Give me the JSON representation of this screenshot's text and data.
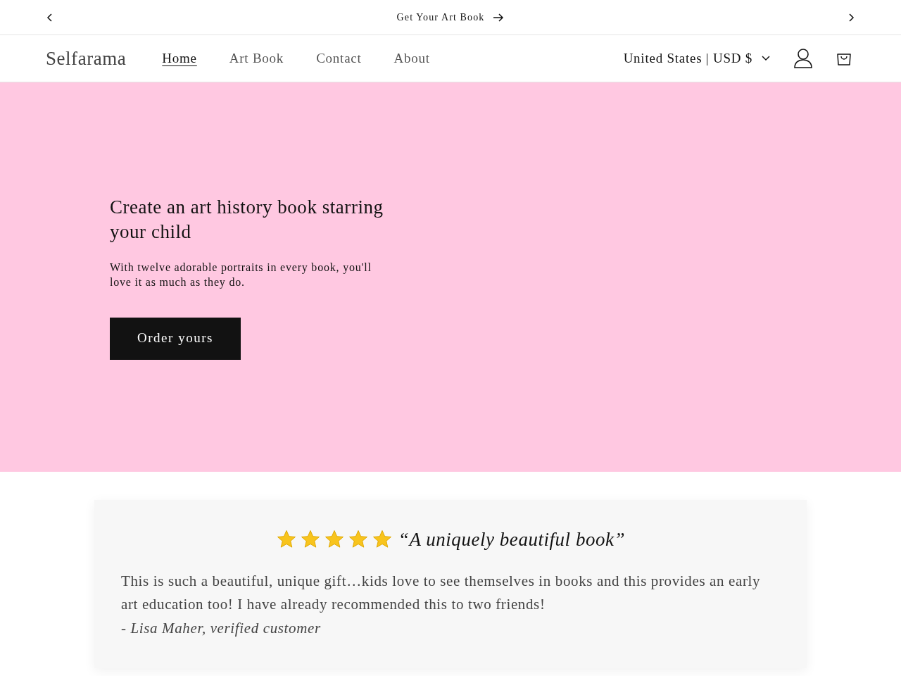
{
  "announcement": {
    "text": "Get Your Art Book"
  },
  "header": {
    "logo": "Selfarama",
    "nav": [
      {
        "label": "Home",
        "selected": true
      },
      {
        "label": "Art Book",
        "selected": false
      },
      {
        "label": "Contact",
        "selected": false
      },
      {
        "label": "About",
        "selected": false
      }
    ],
    "currency": "United States | USD $"
  },
  "hero": {
    "heading": "Create an art history book starring your child",
    "text": "With twelve adorable portraits in every book, you'll love it as much as they do.",
    "button": "Order yours"
  },
  "review": {
    "stars": 5,
    "title": "“A uniquely beautiful book”",
    "body": "This is such a beautiful, unique gift…kids love to see themselves in books and this provides an early art education too! I have already recommended this to two friends!",
    "author": "- Lisa Maher, verified customer"
  }
}
